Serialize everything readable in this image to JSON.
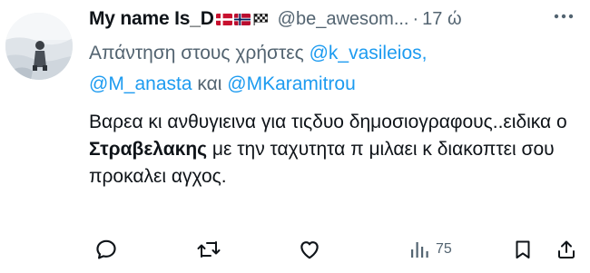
{
  "author": {
    "display_name": "My name Is_D",
    "flags": [
      "denmark-flag",
      "norway-flag",
      "checkered-flag"
    ],
    "handle": "@be_awesom...",
    "separator": "·",
    "time": "17 ώ"
  },
  "reply_to": {
    "prefix": "Απάντηση στους χρήστες ",
    "mention_1": "@k_vasileios,",
    "mention_2": "@M_anasta",
    "conjunction": " και ",
    "mention_3": "@MKaramitrou"
  },
  "tweet": {
    "text_part1": "Βαρεα κι ανθυγιεινα για τιςδυο δημοσιογραφους..ειδικα ο ",
    "bold_name": "Στραβελακης",
    "text_part2": " με την ταχυτητα π μιλαει κ διακοπτει σου προκαλει αγχος."
  },
  "actions": {
    "reply_icon": "reply-icon",
    "retweet_icon": "retweet-icon",
    "like_icon": "heart-icon",
    "views_icon": "views-bar-icon",
    "views_count": "75",
    "bookmark_icon": "bookmark-icon",
    "share_icon": "share-icon"
  },
  "colors": {
    "text": "#0f1419",
    "muted": "#536471",
    "link": "#1d9bf0"
  }
}
